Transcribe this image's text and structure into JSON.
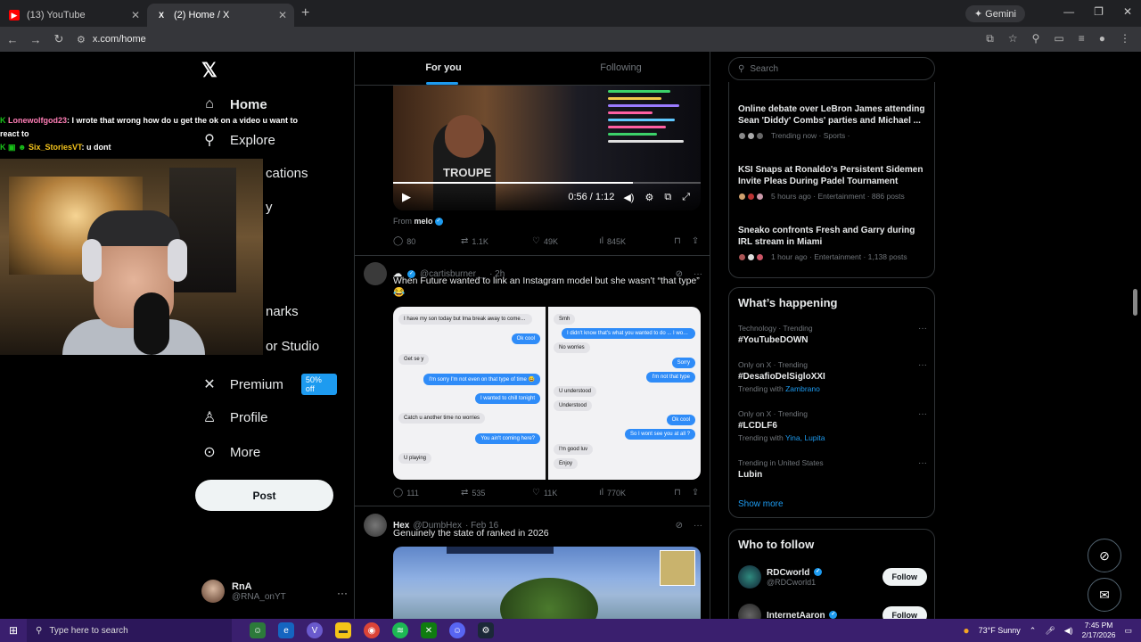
{
  "browser": {
    "tabs": [
      {
        "title": "(13) YouTube",
        "favicon": "youtube-icon",
        "active": false
      },
      {
        "title": "(2) Home / X",
        "favicon": "x-icon",
        "active": true
      }
    ],
    "gemini_label": "Gemini",
    "url": "x.com/home"
  },
  "overlay_chat": {
    "messages": [
      {
        "user": "Lonewolfgod23",
        "text": ": I wrote that wrong how do u get the ok on a video u want to react to"
      },
      {
        "user": "Six_StoriesVT",
        "text": ": u dont"
      }
    ]
  },
  "nav": {
    "items": [
      {
        "label": "Home",
        "icon": "home-icon"
      },
      {
        "label": "Explore",
        "icon": "search-icon"
      },
      {
        "label": "cations",
        "icon": "bell-icon"
      },
      {
        "label": "y",
        "icon": "grok-icon"
      },
      {
        "label": "narks",
        "icon": "bookmark-icon"
      },
      {
        "label": "or Studio",
        "icon": "studio-icon"
      },
      {
        "label": "Premium",
        "icon": "x-icon"
      },
      {
        "label": "Profile",
        "icon": "person-icon"
      },
      {
        "label": "More",
        "icon": "more-circle-icon"
      }
    ],
    "premium_badge": "50% off",
    "post_label": "Post",
    "account": {
      "name": "RnA",
      "handle": "@RNA_onYT"
    }
  },
  "feed": {
    "tabs": [
      "For you",
      "Following"
    ],
    "video": {
      "time": "0:56 / 1:12",
      "progress": 0.78,
      "shirt_text": "TROUPE",
      "from_label": "From",
      "from_user": "melo"
    },
    "post1_stats": {
      "replies": "80",
      "reposts": "1.1K",
      "likes": "49K",
      "views": "845K"
    },
    "post2": {
      "handle": "@cartisburner__",
      "time": "· 2h",
      "text": "When Future wanted to link an Instagram model but she wasn’t “that type” 😂",
      "chat_left": [
        {
          "side": "in",
          "text": "I have my son today but Ima break away to come see u for a sec"
        },
        {
          "side": "out",
          "text": "Ok cool"
        },
        {
          "side": "in",
          "text": "Get se y"
        },
        {
          "side": "out",
          "text": "I'm sorry I'm not even on that type of time 😅"
        },
        {
          "side": "out",
          "text": "I wanted to chill tonight"
        },
        {
          "side": "in",
          "text": "Catch u another time no worries"
        },
        {
          "side": "out",
          "text": "You ain't coming here?"
        },
        {
          "side": "in",
          "text": "U playing"
        }
      ],
      "chat_right": [
        {
          "side": "in",
          "text": "Smh"
        },
        {
          "side": "out",
          "text": "I didn't know that's what you wanted to do ... I would've told you"
        },
        {
          "side": "in",
          "text": "No worries"
        },
        {
          "side": "out",
          "text": "Sorry"
        },
        {
          "side": "out",
          "text": "I'm not that type"
        },
        {
          "side": "in",
          "text": "U understood"
        },
        {
          "side": "in",
          "text": "Understood"
        },
        {
          "side": "out",
          "text": "Ok cool"
        },
        {
          "side": "out",
          "text": "So I wont see you at all ?"
        },
        {
          "side": "in",
          "text": "I'm good luv"
        },
        {
          "side": "in",
          "text": "Enjoy"
        }
      ],
      "stats": {
        "replies": "111",
        "reposts": "535",
        "likes": "11K",
        "views": "770K"
      }
    },
    "post3": {
      "name": "Hex",
      "handle": "@DumbHex",
      "time": "· Feb 16",
      "text": "Genuinely the state of ranked in 2026"
    }
  },
  "right": {
    "search_placeholder": "Search",
    "news": [
      {
        "title": "Online debate over LeBron James attending Sean 'Diddy' Combs' parties and Michael ...",
        "meta": "Trending now · Sports ·"
      },
      {
        "title": "KSI Snaps at Ronaldo's Persistent Sidemen Invite Pleas During Padel Tournament",
        "meta": "5 hours ago · Entertainment · 886 posts"
      },
      {
        "title": "Sneako confronts Fresh and Garry during IRL stream in Miami",
        "meta": "1 hour ago · Entertainment · 1,138 posts"
      }
    ],
    "happening_title": "What’s happening",
    "trends": [
      {
        "context": "Technology · Trending",
        "name": "#YouTubeDOWN",
        "with_label": "",
        "with": ""
      },
      {
        "context": "Only on X · Trending",
        "name": "#DesafioDelSigloXXI",
        "with_label": "Trending with",
        "with": "Zambrano"
      },
      {
        "context": "Only on X · Trending",
        "name": "#LCDLF6",
        "with_label": "Trending with",
        "with": "Yina, Lupita"
      },
      {
        "context": "Trending in United States",
        "name": "Lubin",
        "with_label": "",
        "with": ""
      }
    ],
    "show_more": "Show more",
    "who_title": "Who to follow",
    "follow": [
      {
        "name": "RDCworld",
        "handle": "@RDCworld1",
        "button": "Follow"
      },
      {
        "name": "InternetAaron",
        "handle": "",
        "button": "Follow"
      }
    ]
  },
  "taskbar": {
    "search_placeholder": "Type here to search",
    "weather": "73°F  Sunny",
    "time": "7:45 PM",
    "date": "2/17/2026"
  },
  "colors": {
    "accent": "#1d9bf0",
    "background": "#000000",
    "taskbar": "#3a1f6e"
  }
}
